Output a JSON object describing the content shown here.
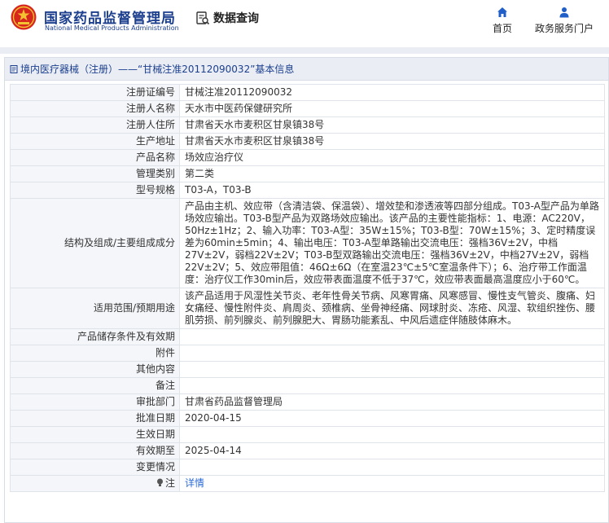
{
  "header": {
    "brand_cn": "国家药品监督管理局",
    "brand_en": "National Medical Products Administration",
    "query_label": "数据查询",
    "nav": [
      {
        "label": "首页",
        "icon": "home-icon"
      },
      {
        "label": "政务服务门户",
        "icon": "user-icon"
      }
    ]
  },
  "panel": {
    "title": "境内医疗器械（注册）——“甘械注准20112090032”基本信息"
  },
  "record": {
    "reg_no_label": "注册证编号",
    "reg_no": "甘械注准20112090032",
    "registrant_label": "注册人名称",
    "registrant": "天水市中医药保健研究所",
    "address_label": "注册人住所",
    "address": "甘肃省天水市麦积区甘泉镇38号",
    "prod_address_label": "生产地址",
    "prod_address": "甘肃省天水市麦积区甘泉镇38号",
    "product_label": "产品名称",
    "product": "场效应治疗仪",
    "category_label": "管理类别",
    "category": "第二类",
    "model_label": "型号规格",
    "model": "T03-A，T03-B",
    "structure_label": "结构及组成/主要组成成分",
    "structure": "产品由主机、效应带（含清洁袋、保温袋）、增效垫和渗透液等四部分组成。T03-A型产品为单路场效应输出。T03-B型产品为双路场效应输出。该产品的主要性能指标：1、电源：AC220V，50Hz±1Hz；2、输入功率：T03-A型：35W±15%；T03-B型：70W±15%；3、定时精度误差为60min±5min；4、输出电压：T03-A型单路输出交流电压：强档36V±2V，中档27V±2V，弱档22V±2V；T03-B型双路输出交流电压：强档36V±2V，中档27V±2V，弱档22V±2V；5、效应带阻值：46Ω±6Ω（在室温23℃±5℃室温条件下）；6、治疗带工作面温度：治疗仪工作30min后，效应带表面温度不低于37℃，效应带表面最高温度应小于60℃。",
    "scope_label": "适用范围/预期用途",
    "scope": "该产品适用于风湿性关节炎、老年性骨关节病、风寒胃痛、风寒感冒、慢性支气管炎、腹痛、妇女痛经、慢性附件炎、肩周炎、颈椎病、坐骨神经痛、网球肘炎、冻疮、风湿、软组织挫伤、腰肌劳损、前列腺炎、前列腺肥大、胃肠功能紊乱、中风后遗症伴随肢体麻木。",
    "storage_label": "产品储存条件及有效期",
    "storage": "",
    "attachment_label": "附件",
    "attachment": "",
    "other_label": "其他内容",
    "other": "",
    "remark_label": "备注",
    "remark": "",
    "approval_dept_label": "审批部门",
    "approval_dept": "甘肃省药品监督管理局",
    "approval_date_label": "批准日期",
    "approval_date": "2020-04-15",
    "effective_date_label": "生效日期",
    "effective_date": "",
    "valid_until_label": "有效期至",
    "valid_until": "2025-04-14",
    "change_label": "变更情况",
    "change": "",
    "note_label": "注",
    "note_link": "详情"
  },
  "colors": {
    "brand_blue": "#1c3f8e",
    "link_blue": "#2b6bd4",
    "nav_icon_blue": "#1f5fc7",
    "logo_red": "#d7261e",
    "logo_gold": "#f2c230"
  }
}
